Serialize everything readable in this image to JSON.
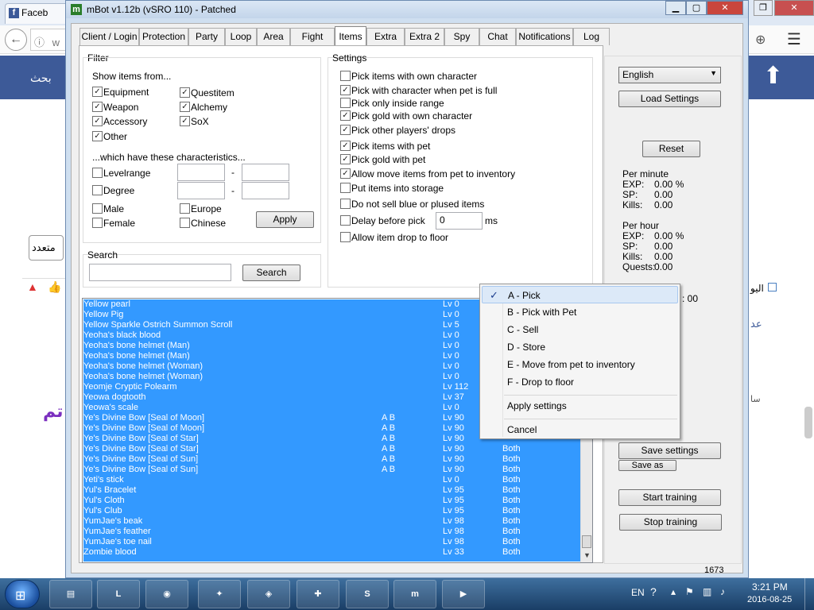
{
  "browser": {
    "tab_title": "Faceb",
    "address_partial": "w",
    "nav_text_1": "بحث",
    "nav_text_2": "متعدد",
    "nav_text_3": "تم",
    "nav_text_4": "اليو",
    "nav_text_5": "عد",
    "nav_text_6": "سا"
  },
  "window": {
    "title": "mBot v1.12b (vSRO 110) - Patched",
    "icon_letter": "m",
    "tabs": [
      "Client / Login",
      "Protection",
      "Party",
      "Loop",
      "Area",
      "Fight",
      "Items",
      "Extra",
      "Extra 2",
      "Spy",
      "Chat",
      "Notifications",
      "Log"
    ],
    "active_tab": "Items"
  },
  "filter": {
    "title": "Filter",
    "show_items_label": "Show items from...",
    "items": [
      {
        "label": "Equipment",
        "checked": true
      },
      {
        "label": "Weapon",
        "checked": true
      },
      {
        "label": "Accessory",
        "checked": true
      },
      {
        "label": "Other",
        "checked": true
      },
      {
        "label": "Questitem",
        "checked": true
      },
      {
        "label": "Alchemy",
        "checked": true
      },
      {
        "label": "SoX",
        "checked": true
      }
    ],
    "characteristics_label": "...which have these characteristics...",
    "levelrange_label": "Levelrange",
    "degree_label": "Degree",
    "dash": "-",
    "male_label": "Male",
    "female_label": "Female",
    "europe_label": "Europe",
    "chinese_label": "Chinese",
    "apply_label": "Apply"
  },
  "search": {
    "title": "Search",
    "value": "",
    "button_label": "Search"
  },
  "settings": {
    "title": "Settings",
    "items": [
      {
        "label": "Pick items with own character",
        "checked": false
      },
      {
        "label": "Pick with character when pet is full",
        "checked": true
      },
      {
        "label": "Pick only inside range",
        "checked": false
      },
      {
        "label": "Pick gold with own character",
        "checked": true
      },
      {
        "label": "Pick other players' drops",
        "checked": true
      },
      {
        "label": "Pick items with pet",
        "checked": true
      },
      {
        "label": "Pick gold with pet",
        "checked": true
      },
      {
        "label": "Allow move items from pet to inventory",
        "checked": true
      },
      {
        "label": "Put items into storage",
        "checked": false
      },
      {
        "label": "Do not sell blue or plused items",
        "checked": false
      },
      {
        "label": "Delay before pick",
        "checked": false
      },
      {
        "label": "Allow item drop to floor",
        "checked": false
      }
    ],
    "delay_value": "0",
    "delay_unit": "ms"
  },
  "items_list": {
    "rows": [
      {
        "name": "Yellow pearl",
        "tags": "",
        "lv": "Lv 0",
        "mode": ""
      },
      {
        "name": "Yellow Pig",
        "tags": "",
        "lv": "Lv 0",
        "mode": ""
      },
      {
        "name": "Yellow Sparkle Ostrich Summon Scroll",
        "tags": "",
        "lv": "Lv 5",
        "mode": ""
      },
      {
        "name": "Yeoha's black blood",
        "tags": "",
        "lv": "Lv 0",
        "mode": ""
      },
      {
        "name": "Yeoha's bone helmet (Man)",
        "tags": "",
        "lv": "Lv 0",
        "mode": ""
      },
      {
        "name": "Yeoha's bone helmet (Man)",
        "tags": "",
        "lv": "Lv 0",
        "mode": ""
      },
      {
        "name": "Yeoha's bone helmet (Woman)",
        "tags": "",
        "lv": "Lv 0",
        "mode": ""
      },
      {
        "name": "Yeoha's bone helmet (Woman)",
        "tags": "",
        "lv": "Lv 0",
        "mode": ""
      },
      {
        "name": "Yeomje Cryptic Polearm",
        "tags": "",
        "lv": "Lv 112",
        "mode": ""
      },
      {
        "name": "Yeowa dogtooth",
        "tags": "",
        "lv": "Lv 37",
        "mode": ""
      },
      {
        "name": "Yeowa's scale",
        "tags": "",
        "lv": "Lv 0",
        "mode": ""
      },
      {
        "name": "Ye's Divine Bow [Seal of Moon]",
        "tags": "A B",
        "lv": "Lv 90",
        "mode": ""
      },
      {
        "name": "Ye's Divine Bow [Seal of Moon]",
        "tags": "A B",
        "lv": "Lv 90",
        "mode": ""
      },
      {
        "name": "Ye's Divine Bow [Seal of Star]",
        "tags": "A B",
        "lv": "Lv 90",
        "mode": ""
      },
      {
        "name": "Ye's Divine Bow [Seal of Star]",
        "tags": "A B",
        "lv": "Lv 90",
        "mode": "Both"
      },
      {
        "name": "Ye's Divine Bow [Seal of Sun]",
        "tags": "A B",
        "lv": "Lv 90",
        "mode": "Both"
      },
      {
        "name": "Ye's Divine Bow [Seal of Sun]",
        "tags": "A B",
        "lv": "Lv 90",
        "mode": "Both"
      },
      {
        "name": "Yeti's stick",
        "tags": "",
        "lv": "Lv 0",
        "mode": "Both"
      },
      {
        "name": "Yul's Bracelet",
        "tags": "",
        "lv": "Lv 95",
        "mode": "Both"
      },
      {
        "name": "Yul's Cloth",
        "tags": "",
        "lv": "Lv 95",
        "mode": "Both"
      },
      {
        "name": "Yul's Club",
        "tags": "",
        "lv": "Lv 95",
        "mode": "Both"
      },
      {
        "name": "YumJae's beak",
        "tags": "",
        "lv": "Lv 98",
        "mode": "Both"
      },
      {
        "name": "YumJae's feather",
        "tags": "",
        "lv": "Lv 98",
        "mode": "Both"
      },
      {
        "name": "YumJae's toe nail",
        "tags": "",
        "lv": "Lv 98",
        "mode": "Both"
      },
      {
        "name": "Zombie blood",
        "tags": "",
        "lv": "Lv 33",
        "mode": "Both"
      }
    ],
    "count": "1673"
  },
  "right_panel": {
    "language": "English",
    "load_settings": "Load Settings",
    "reset": "Reset",
    "per_minute_label": "Per minute",
    "per_minute": [
      {
        "k": "EXP:",
        "v": "0.00 %"
      },
      {
        "k": "SP:",
        "v": "0.00"
      },
      {
        "k": "Kills:",
        "v": "0.00"
      }
    ],
    "per_hour_label": "Per hour",
    "per_hour": [
      {
        "k": "EXP:",
        "v": "0.00 %"
      },
      {
        "k": "SP:",
        "v": "0.00"
      },
      {
        "k": "Kills:",
        "v": "0.00"
      },
      {
        "k": "Quests:",
        "v": "0.00"
      }
    ],
    "partial_time": ": 00",
    "save_settings": "Save settings",
    "save_as": "Save as",
    "start_training": "Start training",
    "stop_training": "Stop training"
  },
  "context_menu": {
    "items": [
      {
        "label": "A - Pick",
        "checked": true
      },
      {
        "label": "B - Pick with Pet",
        "checked": false
      },
      {
        "label": "C - Sell",
        "checked": false
      },
      {
        "label": "D - Store",
        "checked": false
      },
      {
        "label": "E - Move from pet to inventory",
        "checked": false
      },
      {
        "label": "F - Drop to floor",
        "checked": false
      }
    ],
    "apply": "Apply settings",
    "cancel": "Cancel",
    "checkmark": "✓"
  },
  "taskbar": {
    "language": "EN",
    "time": "3:21 PM",
    "date": "2016-08-25"
  }
}
